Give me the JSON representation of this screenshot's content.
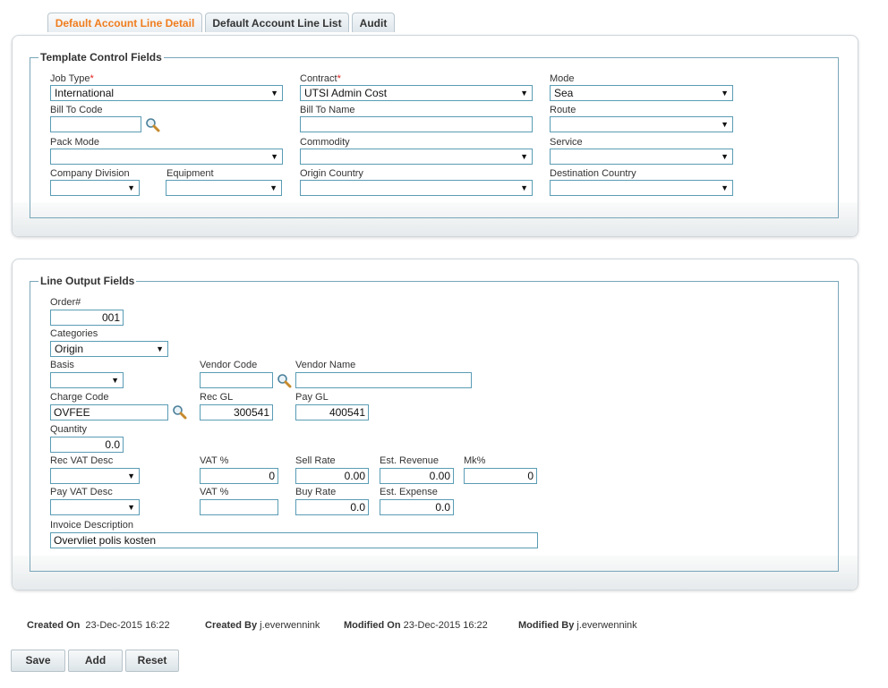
{
  "tabs": [
    {
      "label": "Default Account Line Detail"
    },
    {
      "label": "Default Account Line List"
    },
    {
      "label": "Audit"
    }
  ],
  "template": {
    "legend": "Template Control Fields",
    "job_type": {
      "label": "Job Type",
      "value": "International"
    },
    "contract": {
      "label": "Contract",
      "value": "UTSI Admin Cost"
    },
    "mode": {
      "label": "Mode",
      "value": "Sea"
    },
    "bill_to_code": {
      "label": "Bill To Code",
      "value": ""
    },
    "bill_to_name": {
      "label": "Bill To Name",
      "value": ""
    },
    "route": {
      "label": "Route",
      "value": ""
    },
    "pack_mode": {
      "label": "Pack Mode",
      "value": ""
    },
    "commodity": {
      "label": "Commodity",
      "value": ""
    },
    "service": {
      "label": "Service",
      "value": ""
    },
    "company_division": {
      "label": "Company Division",
      "value": ""
    },
    "equipment": {
      "label": "Equipment",
      "value": ""
    },
    "origin_country": {
      "label": "Origin Country",
      "value": ""
    },
    "destination_country": {
      "label": "Destination Country",
      "value": ""
    }
  },
  "output": {
    "legend": "Line Output Fields",
    "order": {
      "label": "Order#",
      "value": "001"
    },
    "categories": {
      "label": "Categories",
      "value": "Origin"
    },
    "basis": {
      "label": "Basis",
      "value": ""
    },
    "vendor_code": {
      "label": "Vendor Code",
      "value": ""
    },
    "vendor_name": {
      "label": "Vendor Name",
      "value": ""
    },
    "charge_code": {
      "label": "Charge Code",
      "value": "OVFEE"
    },
    "rec_gl": {
      "label": "Rec GL",
      "value": "300541"
    },
    "pay_gl": {
      "label": "Pay GL",
      "value": "400541"
    },
    "quantity": {
      "label": "Quantity",
      "value": "0.0"
    },
    "rec_vat_desc": {
      "label": "Rec VAT Desc",
      "value": ""
    },
    "vat_pct_rec": {
      "label": "VAT %",
      "value": "0"
    },
    "sell_rate": {
      "label": "Sell Rate",
      "value": "0.00"
    },
    "est_revenue": {
      "label": "Est. Revenue",
      "value": "0.00"
    },
    "mk_pct": {
      "label": "Mk%",
      "value": "0"
    },
    "pay_vat_desc": {
      "label": "Pay VAT Desc",
      "value": ""
    },
    "vat_pct_pay": {
      "label": "VAT %",
      "value": ""
    },
    "buy_rate": {
      "label": "Buy Rate",
      "value": "0.0"
    },
    "est_expense": {
      "label": "Est. Expense",
      "value": "0.0"
    },
    "invoice_description": {
      "label": "Invoice Description",
      "value": "Overvliet polis kosten"
    }
  },
  "meta": {
    "created_on_label": "Created On",
    "created_on": "23-Dec-2015 16:22",
    "created_by_label": "Created By",
    "created_by": "j.everwennink",
    "modified_on_label": "Modified On",
    "modified_on": "23-Dec-2015 16:22",
    "modified_by_label": "Modified By",
    "modified_by": "j.everwennink"
  },
  "buttons": {
    "save": "Save",
    "add": "Add",
    "reset": "Reset"
  },
  "symbols": {
    "required": "*",
    "dropdown_arrow": "▼"
  },
  "icons": {
    "lookup": "magnifier-icon"
  },
  "colors": {
    "accent": "#f07d1e",
    "border": "#5a9cb5",
    "required": "#e0201e"
  }
}
